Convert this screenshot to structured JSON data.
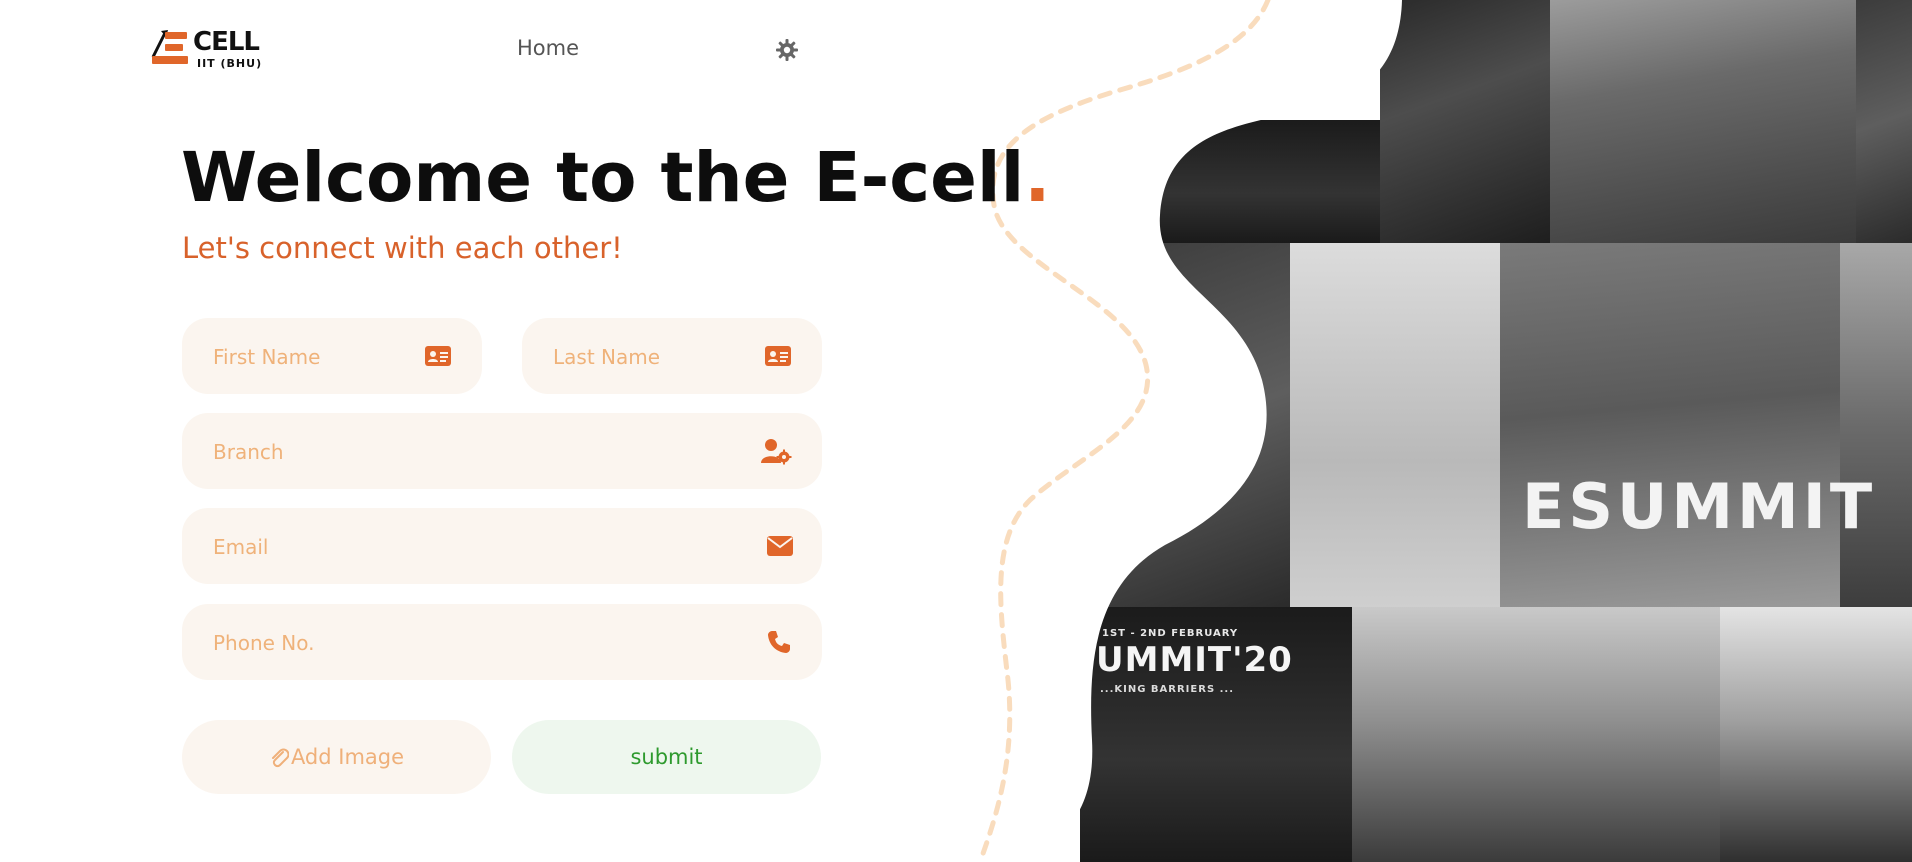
{
  "header": {
    "logo": {
      "brand": "CELL",
      "sub": "IIT (BHU)",
      "icon": "e-cell-logo-icon"
    },
    "nav": {
      "home_label": "Home"
    },
    "theme_icon": "gear-icon"
  },
  "hero": {
    "title": "Welcome to the E-cell",
    "title_dot": ".",
    "subtitle": "Let's connect with each other!"
  },
  "form": {
    "first_name": {
      "placeholder": "First Name",
      "value": "",
      "icon": "id-card-icon"
    },
    "last_name": {
      "placeholder": "Last Name",
      "value": "",
      "icon": "id-card-icon"
    },
    "branch": {
      "placeholder": "Branch",
      "value": "",
      "icon": "user-gear-icon"
    },
    "email": {
      "placeholder": "Email",
      "value": "",
      "icon": "envelope-icon"
    },
    "phone": {
      "placeholder": "Phone No.",
      "value": "",
      "icon": "phone-icon"
    },
    "add_image_label": "Add Image",
    "add_image_icon": "paperclip-icon",
    "submit_label": "submit"
  },
  "collage": {
    "banner_text_1": "ESUMMIT",
    "banner_date": "1ST - 2ND FEBRUARY",
    "banner_text_2": "UMMIT'20",
    "banner_tagline": "...KING BARRIERS ..."
  },
  "colors": {
    "accent": "#e0662a",
    "field_bg": "#fbf5ef",
    "placeholder": "#efb27a",
    "submit_bg": "#eef7ee",
    "submit_text": "#2e9a2e",
    "dashed_curve": "#f9dcbd"
  }
}
